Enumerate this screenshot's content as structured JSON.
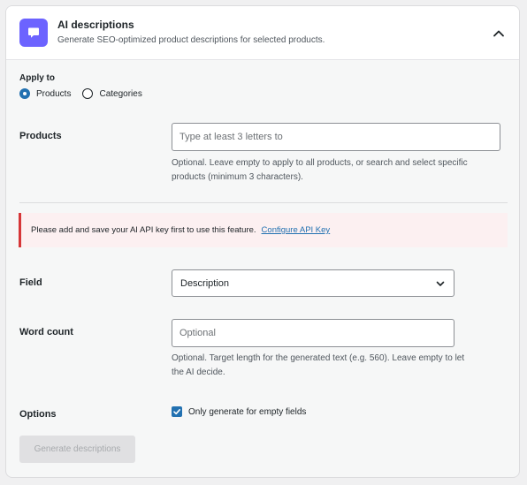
{
  "header": {
    "title": "AI descriptions",
    "subtitle": "Generate SEO-optimized product descriptions for selected products."
  },
  "apply_to": {
    "label": "Apply to",
    "options": [
      "Products",
      "Categories"
    ],
    "selected": "Products"
  },
  "products": {
    "label": "Products",
    "placeholder": "Type at least 3 letters to",
    "help_line1": "Optional. Leave empty to apply to all products, or search and select specific",
    "help_line2": "products (minimum 3 characters)."
  },
  "notice": {
    "text": "Please add and save your AI API key first to use this feature.",
    "link": "Configure API Key"
  },
  "field": {
    "label": "Field",
    "value": "Description"
  },
  "word_count": {
    "label": "Word count",
    "placeholder": "Optional",
    "help_line1": "Optional. Target length for the generated text (e.g. 560). Leave empty to let",
    "help_line2": "the AI decide."
  },
  "options": {
    "label": "Options",
    "checkbox_label": "Only generate for empty fields",
    "checked": true
  },
  "generate_button": "Generate descriptions",
  "colors": {
    "accent": "#6c63ff",
    "primary": "#2271b1",
    "notice_border": "#d63638",
    "notice_bg": "#fcf0f1"
  }
}
